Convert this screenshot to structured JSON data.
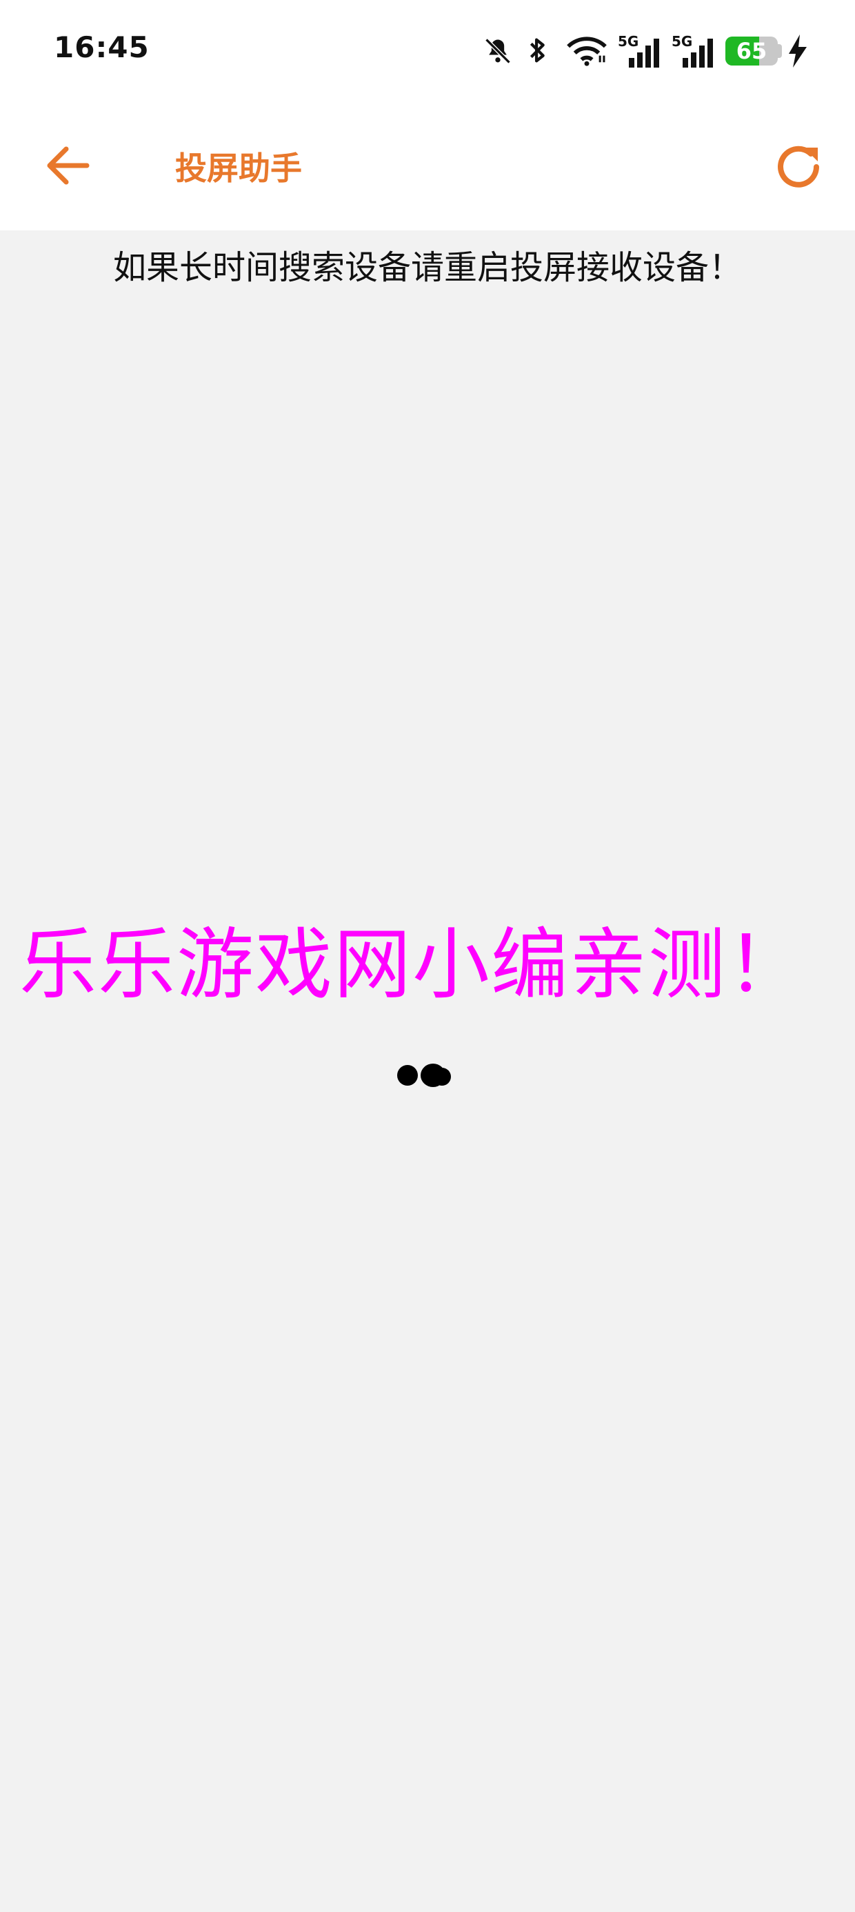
{
  "status_bar": {
    "time": "16:45",
    "battery_level": 65,
    "battery_label": "65",
    "network_label_1": "5G",
    "network_label_2": "5G",
    "icons": [
      "bell-muted-icon",
      "bluetooth-icon",
      "wifi-icon",
      "signal-5g-icon",
      "signal-5g-icon",
      "battery-icon",
      "charging-icon"
    ],
    "battery_color": "#1fb824"
  },
  "app_bar": {
    "title": "投屏助手",
    "back_icon": "arrow-left-icon",
    "refresh_icon": "refresh-icon",
    "accent_color": "#e8782c"
  },
  "main": {
    "hint": "如果长时间搜索设备请重启投屏接收设备！",
    "loading_icon": "loading-dots-icon"
  },
  "watermark": {
    "text": "乐乐游戏网小编亲测！",
    "color": "#ff00ff"
  }
}
